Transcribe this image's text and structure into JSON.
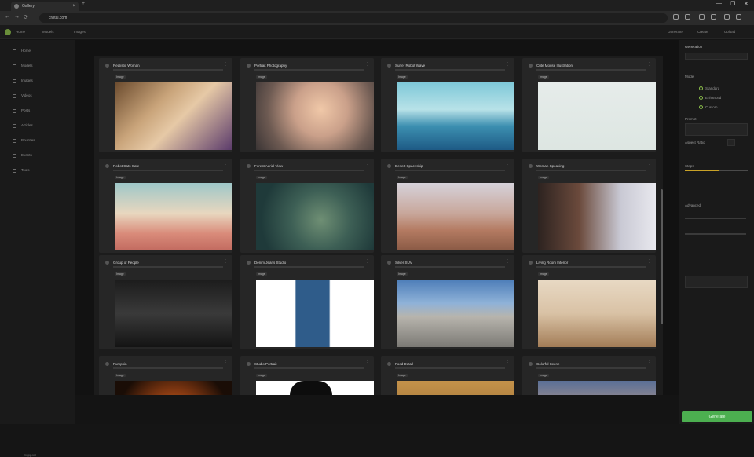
{
  "browser": {
    "tab_title": "Gallery",
    "tab_close": "×",
    "new_tab": "+",
    "url": "civitai.com",
    "nav": [
      "←",
      "→",
      "⟳"
    ],
    "win": [
      "—",
      "❐",
      "✕"
    ]
  },
  "appbar": {
    "items": [
      "Home",
      "Models",
      "Images",
      "Videos",
      "Posts",
      "Articles"
    ],
    "right": [
      "Generate",
      "Create",
      "Upload"
    ]
  },
  "sidebar": {
    "items": [
      "Home",
      "Models",
      "Images",
      "Videos",
      "Posts",
      "Articles",
      "Bounties",
      "Events",
      "Shop",
      "Creators",
      "Tools"
    ],
    "footer": "Support"
  },
  "gallery": {
    "cards": [
      {
        "title": "Realistic Woman",
        "chip": "Image"
      },
      {
        "title": "Portrait Photography",
        "chip": "Image"
      },
      {
        "title": "Surfer Robot Wave",
        "chip": "Image"
      },
      {
        "title": "Cute Mouse Illustration",
        "chip": "Image"
      },
      {
        "title": "Robot Cats Cafe",
        "chip": "Image"
      },
      {
        "title": "Forest Aerial View",
        "chip": "Image"
      },
      {
        "title": "Desert Spaceship",
        "chip": "Image"
      },
      {
        "title": "Woman Speaking",
        "chip": "Image"
      },
      {
        "title": "Group of People",
        "chip": "Image"
      },
      {
        "title": "Denim Jeans Studio",
        "chip": "Image"
      },
      {
        "title": "Silver SUV",
        "chip": "Image"
      },
      {
        "title": "Living Room Interior",
        "chip": "Image"
      },
      {
        "title": "Pumpkin",
        "chip": "Image"
      },
      {
        "title": "Studio Portrait",
        "chip": "Image"
      },
      {
        "title": "Food Detail",
        "chip": "Image"
      },
      {
        "title": "Colorful Scene",
        "chip": "Image"
      }
    ]
  },
  "rightpanel": {
    "title": "Generation",
    "section1": "Model",
    "radios": [
      "Standard",
      "Enhanced",
      "Custom"
    ],
    "section2": "Prompt",
    "label_size": "Aspect Ratio",
    "label_steps": "Steps",
    "label_cfg": "Advanced",
    "slider_fraction": 0.55,
    "generate": "Generate"
  }
}
